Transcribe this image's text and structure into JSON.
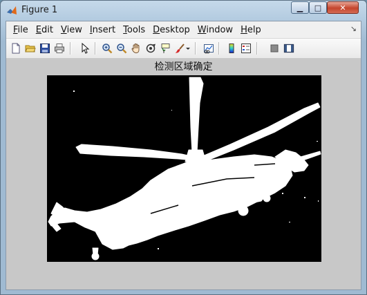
{
  "window": {
    "title": "Figure 1",
    "minimize_glyph": "▁",
    "maximize_glyph": "□",
    "close_glyph": "✕"
  },
  "menubar": {
    "items": [
      {
        "underline": "F",
        "rest": "ile"
      },
      {
        "underline": "E",
        "rest": "dit"
      },
      {
        "underline": "V",
        "rest": "iew"
      },
      {
        "underline": "I",
        "rest": "nsert"
      },
      {
        "underline": "T",
        "rest": "ools"
      },
      {
        "underline": "D",
        "rest": "esktop"
      },
      {
        "underline": "W",
        "rest": "indow"
      },
      {
        "underline": "H",
        "rest": "elp"
      }
    ],
    "dock_glyph": "↘"
  },
  "toolbar": {
    "buttons": [
      "new-figure",
      "open-file",
      "save-figure",
      "print-figure",
      "edit-plot",
      "zoom-in",
      "zoom-out",
      "pan",
      "rotate-3d",
      "data-cursor",
      "brush",
      "brush-dropdown",
      "link-plot",
      "insert-colorbar",
      "insert-legend",
      "hide-plot-tools",
      "show-plot-tools"
    ]
  },
  "figure": {
    "axes_title": "检测区域确定",
    "image_description_colors": {
      "background": "#000000",
      "foreground": "#ffffff"
    }
  },
  "colors": {
    "figure_background": "#c8c8c8",
    "titlebar": "#b3cbe0",
    "close_button": "#c5452c"
  }
}
